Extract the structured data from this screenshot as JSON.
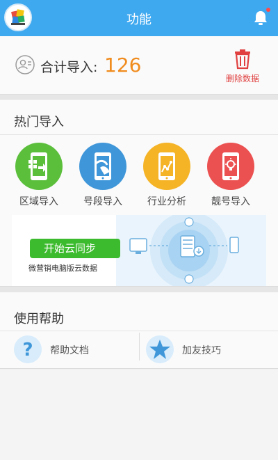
{
  "header": {
    "title": "功能",
    "avatar_icon": "app-logo-icon",
    "notify_icon": "bell-icon",
    "accent": "#3fa9f0"
  },
  "summary": {
    "label": "合计导入:",
    "count": "126",
    "delete_label": "删除数据",
    "count_color": "#f08c1e"
  },
  "hot": {
    "heading": "热门导入",
    "items": [
      {
        "label": "区域导入",
        "icon": "phone-grid-icon",
        "color": "#5cbf3c"
      },
      {
        "label": "号段导入",
        "icon": "phone-hand-icon",
        "color": "#3f97d9"
      },
      {
        "label": "行业分析",
        "icon": "phone-chart-icon",
        "color": "#f5b326"
      },
      {
        "label": "靓号导入",
        "icon": "phone-bulb-icon",
        "color": "#ec5151"
      }
    ],
    "banner": {
      "button": "开始云同步",
      "subtitle": "微营销电脑版云数据"
    }
  },
  "help": {
    "heading": "使用帮助",
    "items": [
      {
        "label": "帮助文档",
        "icon": "question-icon"
      },
      {
        "label": "加友技巧",
        "icon": "star-icon"
      }
    ]
  }
}
